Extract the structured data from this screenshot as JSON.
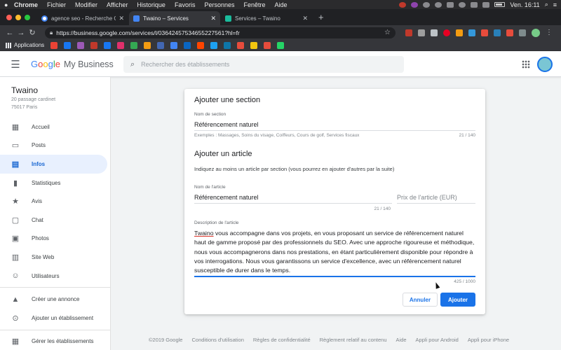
{
  "menubar": {
    "app": "Chrome",
    "items": [
      "Fichier",
      "Modifier",
      "Afficher",
      "Historique",
      "Favoris",
      "Personnes",
      "Fenêtre",
      "Aide"
    ],
    "clock": "Ven. 16:11"
  },
  "tabs": [
    {
      "title": "agence seo - Recherche Google",
      "color": "#4285f4"
    },
    {
      "title": "Twaino – Services",
      "color": "#4285f4"
    },
    {
      "title": "Services – Twaino",
      "color": "#1abc9c"
    }
  ],
  "toolbar": {
    "url": "https://business.google.com/services/l/03642457534655227561?hl=fr"
  },
  "bookmarks": {
    "apps_label": "Applications",
    "colors": [
      "#ea4335",
      "#1877f2",
      "#9b59b6",
      "#c0392b",
      "#1877f2",
      "#e1306c",
      "#34a853",
      "#f39c12",
      "#4267b2",
      "#4285f4",
      "#0a66c2",
      "#ff4500",
      "#1da1f2",
      "#0e76a8",
      "#e74c3c",
      "#f1c40f",
      "#e74c3c",
      "#25d366"
    ]
  },
  "header": {
    "logo": [
      "G",
      "o",
      "o",
      "g",
      "l",
      "e"
    ],
    "product": "My Business",
    "search_placeholder": "Rechercher des établissements"
  },
  "sidebar": {
    "biz_name": "Twaino",
    "address_line1": "20 passage cardinet",
    "address_line2": "75017 Paris",
    "items": [
      {
        "label": "Accueil",
        "icon": "dashboard-icon",
        "glyph": "▦"
      },
      {
        "label": "Posts",
        "icon": "posts-icon",
        "glyph": "▭"
      },
      {
        "label": "Infos",
        "icon": "store-icon",
        "glyph": "▤"
      },
      {
        "label": "Statistiques",
        "icon": "bar-chart-icon",
        "glyph": "▮"
      },
      {
        "label": "Avis",
        "icon": "star-icon",
        "glyph": "★"
      },
      {
        "label": "Chat",
        "icon": "chat-icon",
        "glyph": "▢"
      },
      {
        "label": "Photos",
        "icon": "photos-icon",
        "glyph": "▣"
      },
      {
        "label": "Site Web",
        "icon": "website-icon",
        "glyph": "▥"
      },
      {
        "label": "Utilisateurs",
        "icon": "add-user-icon",
        "glyph": "☺"
      }
    ],
    "extra": [
      {
        "label": "Créer une annonce",
        "icon": "ads-icon",
        "glyph": "▲"
      },
      {
        "label": "Ajouter un établissement",
        "icon": "location-pin-icon",
        "glyph": "⊙"
      }
    ],
    "manage": {
      "label": "Gérer les établissements",
      "icon": "manage-icon",
      "glyph": "▦"
    }
  },
  "dialog": {
    "title": "Ajouter une section",
    "section_label": "Nom de section",
    "section_value": "Référencement naturel",
    "section_hint": "Exemples : Massages, Soins du visage, Coiffeurs, Cours de golf, Services fiscaux",
    "section_count": "21 / 140",
    "article_title": "Ajouter un article",
    "instruction": "Indiquez au moins un article par section (vous pourrez en ajouter d'autres par la suite)",
    "item_label": "Nom de l'article",
    "item_value": "Référencement naturel",
    "item_count": "21 / 140",
    "price_placeholder": "Prix de l'article (EUR)",
    "desc_label": "Description de l'article",
    "desc_first_word": "Twaino",
    "desc_rest": " vous accompagne dans vos projets, en vous proposant un service de référencement naturel haut de gamme proposé par des professionnels du SEO. Avec une approche rigoureuse et méthodique, nous vous accompagnerons dans nos prestations, en étant particulièrement disponible pour répondre à vos interrogations. Nous vous garantissons un service d'excellence, avec un référencement naturel susceptible de durer dans le temps.",
    "desc_count": "425 / 1000",
    "cancel": "Annuler",
    "add": "Ajouter"
  },
  "footer": [
    "©2019 Google",
    "Conditions d'utilisation",
    "Règles de confidentialité",
    "Règlement relatif au contenu",
    "Aide",
    "Appli pour Android",
    "Appli pour iPhone"
  ]
}
